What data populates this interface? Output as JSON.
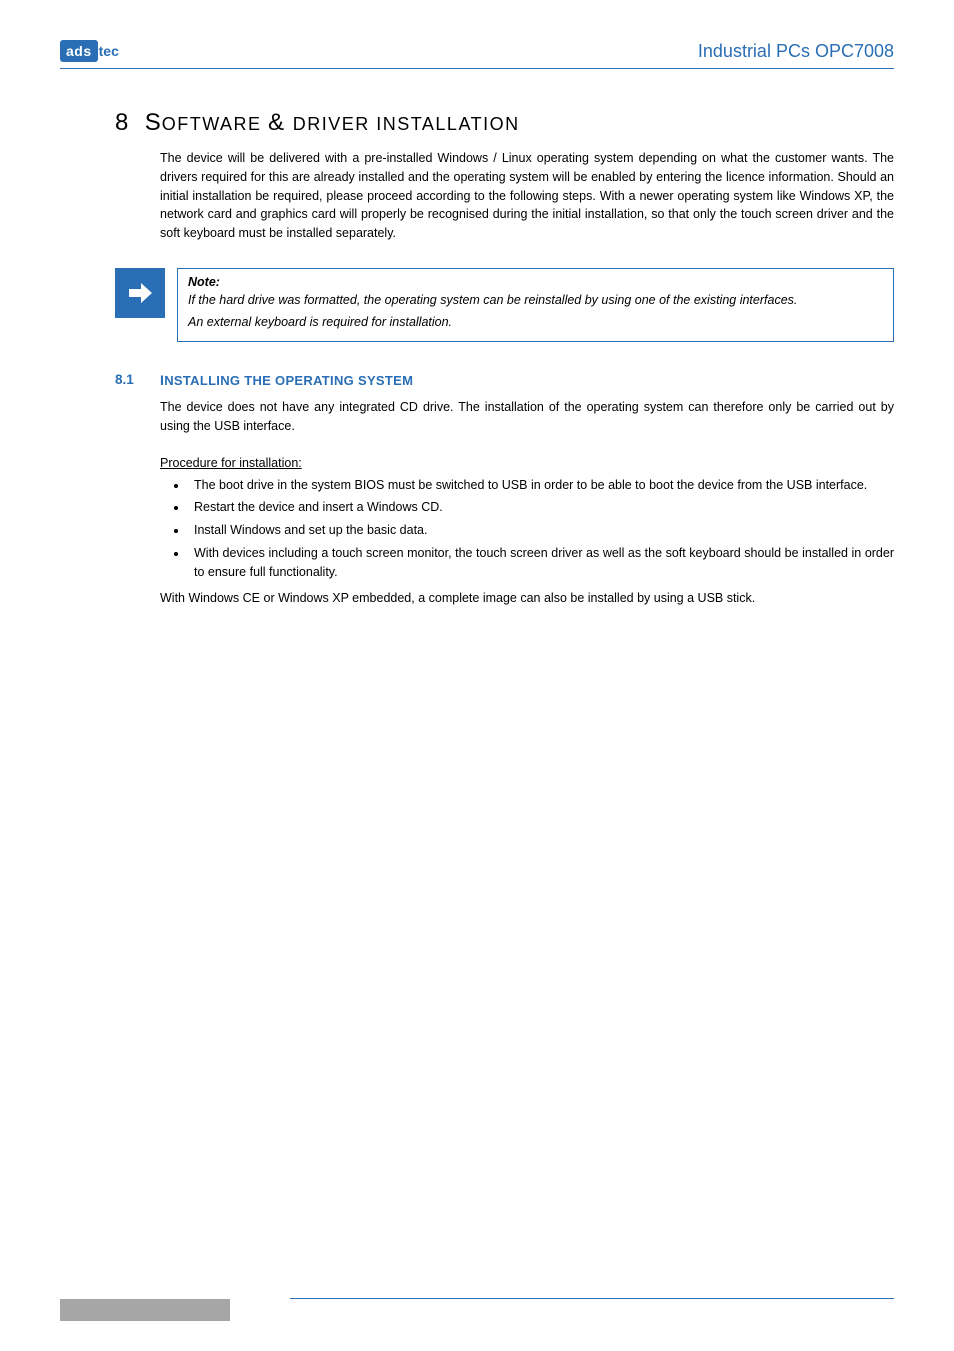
{
  "header": {
    "logo_left": "ads",
    "logo_right": "tec",
    "product_title": "Industrial PCs OPC7008"
  },
  "section": {
    "number": "8",
    "title_big_1": "S",
    "title_small_1": "OFTWARE ",
    "title_big_2": "& ",
    "title_small_2": "DRIVER INSTALLATION",
    "intro": "The device will be delivered with a pre-installed Windows / Linux operating system depending on what the customer wants. The drivers required for this are already installed and the operating system will be enabled by entering the licence information. Should an initial installation be required, please proceed according to the following steps. With a newer operating system like Windows XP, the network card and graphics card will properly be recognised during the initial installation, so that only the touch screen driver and the soft keyboard must be installed separately."
  },
  "note": {
    "label": "Note:",
    "line1": "If the hard drive was formatted, the operating system can be reinstalled by using one of the existing interfaces.",
    "line2": "An external keyboard is required for installation."
  },
  "subsection": {
    "num": "8.1",
    "title_first": "I",
    "title_rest": "NSTALLING THE OPERATING SYSTEM",
    "intro": "The device does not have any integrated CD drive. The installation of the operating system can therefore only be carried out by using the USB interface.",
    "proc_title": "Procedure for installation:",
    "bullets": [
      "The boot drive in the system BIOS must be switched to USB in order to be able to boot the device from the USB interface.",
      "Restart the device and insert a Windows CD.",
      "Install Windows and set up the basic data.",
      "With devices including a touch screen monitor, the touch screen driver as well as the soft keyboard should be installed in order to ensure full functionality."
    ],
    "outro": "With Windows CE or Windows XP embedded, a complete image can also be installed by using a USB stick."
  }
}
